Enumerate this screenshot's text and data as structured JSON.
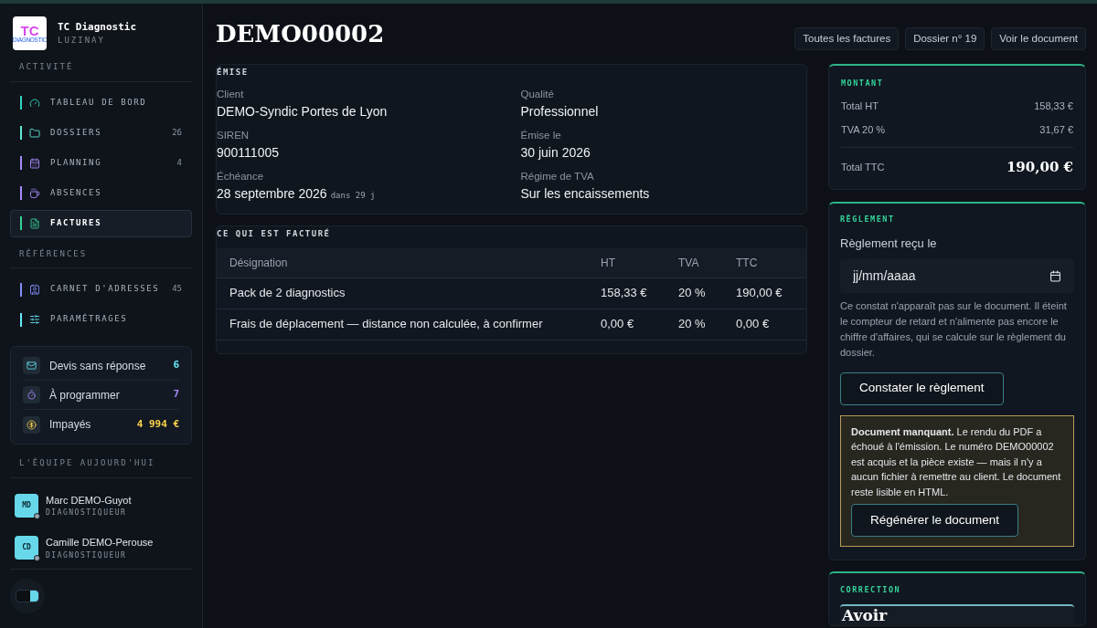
{
  "brand": {
    "logo": "TC",
    "logo_sub": "DIAGNOSTIC",
    "name": "TC Diagnostic",
    "city": "LUZINAY"
  },
  "nav_sections": [
    {
      "title": "ACTIVITÉ",
      "items": [
        {
          "label": "TABLEAU DE BORD",
          "color": "#2dd4bf",
          "selected": false
        },
        {
          "label": "DOSSIERS",
          "count": "26",
          "color": "#5eead4",
          "selected": false
        },
        {
          "label": "PLANNING",
          "count": "4",
          "color": "#a78bfa",
          "selected": false
        },
        {
          "label": "ABSENCES",
          "color": "#a78bfa",
          "selected": false
        },
        {
          "label": "FACTURES",
          "color": "#34d399",
          "selected": true
        }
      ]
    },
    {
      "title": "RÉFÉRENCES",
      "items": [
        {
          "label": "CARNET D'ADRESSES",
          "count": "45",
          "color": "#818cf8",
          "selected": false
        },
        {
          "label": "PARAMÉTRAGES",
          "color": "#67e8f9",
          "selected": false
        }
      ]
    }
  ],
  "alerts": [
    {
      "label": "Devis sans réponse",
      "value": "6",
      "color": "#67e8f9"
    },
    {
      "label": "À programmer",
      "value": "7",
      "color": "#a78bfa"
    },
    {
      "label": "Impayés",
      "value": "4 994 €",
      "color": "#fcd34d"
    }
  ],
  "team": {
    "title": "L'ÉQUIPE AUJOURD'HUI",
    "members": [
      {
        "initials": "MD",
        "name": "Marc DEMO-Guyot",
        "role": "DIAGNOSTIQUEUR"
      },
      {
        "initials": "CD",
        "name": "Camille DEMO-Perouse",
        "role": "DIAGNOSTIQUEUR"
      }
    ]
  },
  "theme_toggle": {
    "on": true
  },
  "title": "DEMO00002",
  "header_buttons": [
    "Toutes les factures",
    "Dossier n° 19",
    "Voir le document"
  ],
  "emise": {
    "title": "ÉMISE",
    "fields": [
      {
        "label": "Client",
        "value": "DEMO-Syndic Portes de Lyon"
      },
      {
        "label": "Qualité",
        "value": "Professionnel"
      },
      {
        "label": "SIREN",
        "value": "900111005"
      },
      {
        "label": "Émise le",
        "value": "30 juin 2026"
      },
      {
        "label": "Échéance",
        "value": "28 septembre 2026",
        "note": "dans 29 j"
      },
      {
        "label": "Régime de TVA",
        "value": "Sur les encaissements"
      }
    ]
  },
  "lines": {
    "title": "CE QUI EST FACTURÉ",
    "columns": [
      "Désignation",
      "HT",
      "TVA",
      "TTC"
    ],
    "rows": [
      [
        "Pack de 2 diagnostics",
        "158,33 €",
        "20 %",
        "190,00 €"
      ],
      [
        "Frais de déplacement — distance non calculée, à confirmer",
        "0,00 €",
        "20 %",
        "0,00 €"
      ]
    ]
  },
  "montant": {
    "title": "MONTANT",
    "rows": [
      {
        "label": "Total HT",
        "value": "158,33 €"
      },
      {
        "label": "TVA 20 %",
        "value": "31,67 €"
      }
    ],
    "total_label": "Total TTC",
    "total_value": "190,00 €"
  },
  "reglement": {
    "title": "RÈGLEMENT",
    "field_label": "Règlement reçu le",
    "placeholder": "jj/mm/aaaa",
    "help": "Ce constat n'apparaît pas sur le document. Il éteint le compteur de retard et n'alimente pas encore le chiffre d'affaires, qui se calcule sur le règlement du dossier.",
    "button": "Constater le règlement",
    "warning": "**Document manquant.** Le rendu du PDF a échoué à l'émission. Le numéro DEMO00002 est acquis et la pièce existe — mais il n'y a aucun fichier à remettre au client. Le document reste lisible en HTML.",
    "warning_button": "Régénérer le document"
  },
  "correction": {
    "title": "CORRECTION",
    "heading": "Avoir"
  }
}
